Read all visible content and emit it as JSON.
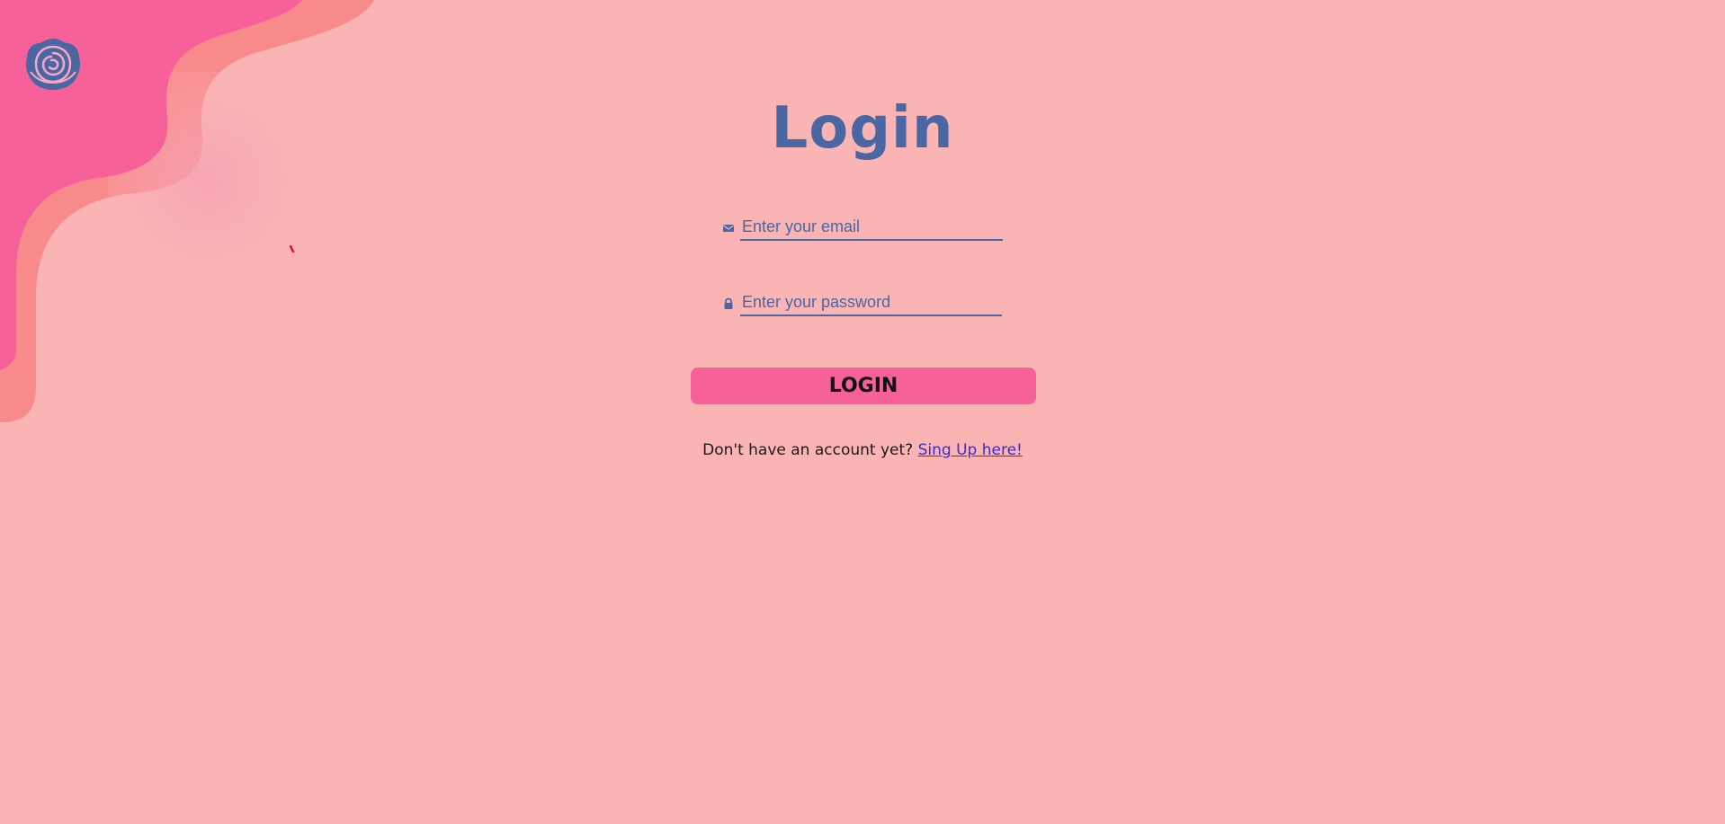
{
  "page": {
    "title": "Login"
  },
  "colors": {
    "background": "#fab4b4",
    "accent": "#4a67a3",
    "button": "#f7619a",
    "blob_dark": "#f7619a",
    "blob_light": "#f98a8c",
    "link": "#3a2bd6"
  },
  "logo": {
    "icon": "rose-icon"
  },
  "form": {
    "email": {
      "icon": "envelope-icon",
      "placeholder": "Enter your email",
      "value": ""
    },
    "password": {
      "icon": "lock-icon",
      "placeholder": "Enter your password",
      "value": ""
    },
    "submit_label": "LOGIN"
  },
  "signup": {
    "prompt": "Don't have an account yet?",
    "link_label": "Sing Up here!"
  }
}
